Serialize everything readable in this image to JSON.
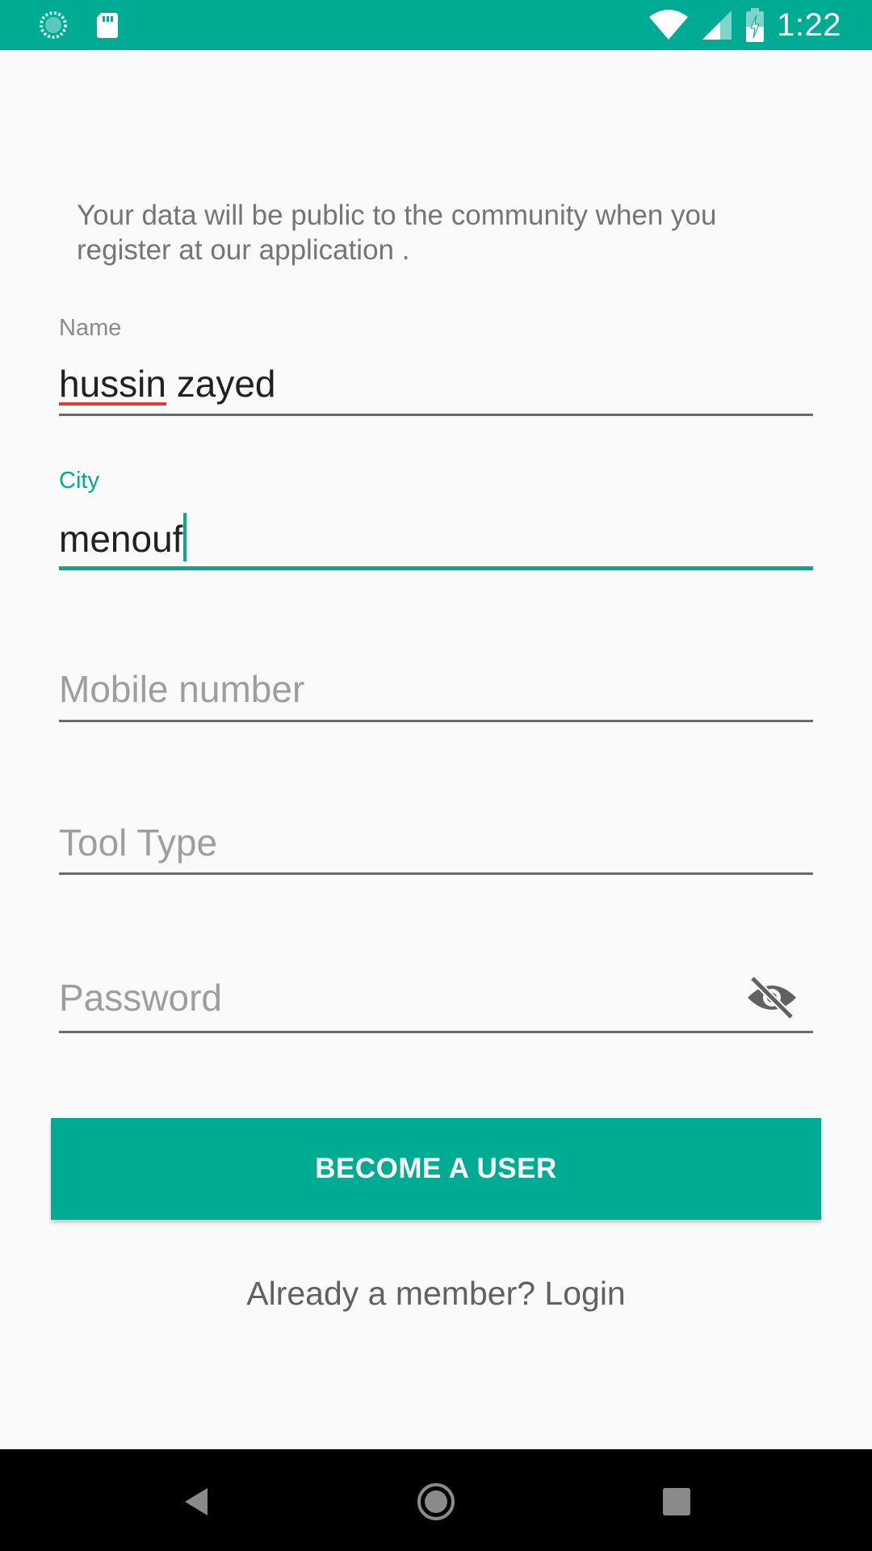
{
  "status_bar": {
    "time": "1:22",
    "icons": [
      "loading-spinner-icon",
      "sd-card-icon",
      "wifi-icon",
      "cell-signal-icon",
      "battery-charging-icon"
    ]
  },
  "colors": {
    "accent": "#00ab94",
    "background": "#fafafa",
    "spell_error": "#e53935",
    "navigation_bar": "#000000"
  },
  "form": {
    "intro_text": "Your data will be public to the community when you register at our application .",
    "name": {
      "label": "Name",
      "value_misspelled_word": "hussin",
      "value_rest": " zayed"
    },
    "city": {
      "label": "City",
      "value": "menouf"
    },
    "mobile": {
      "placeholder": "Mobile number"
    },
    "tool_type": {
      "placeholder": "Tool Type"
    },
    "password": {
      "placeholder": "Password",
      "visibility_icon": "eye-off-icon"
    },
    "submit_label": "BECOME A USER",
    "login_link": "Already a member? Login"
  },
  "navigation": {
    "buttons": [
      "back-icon",
      "home-icon",
      "recents-icon"
    ]
  }
}
